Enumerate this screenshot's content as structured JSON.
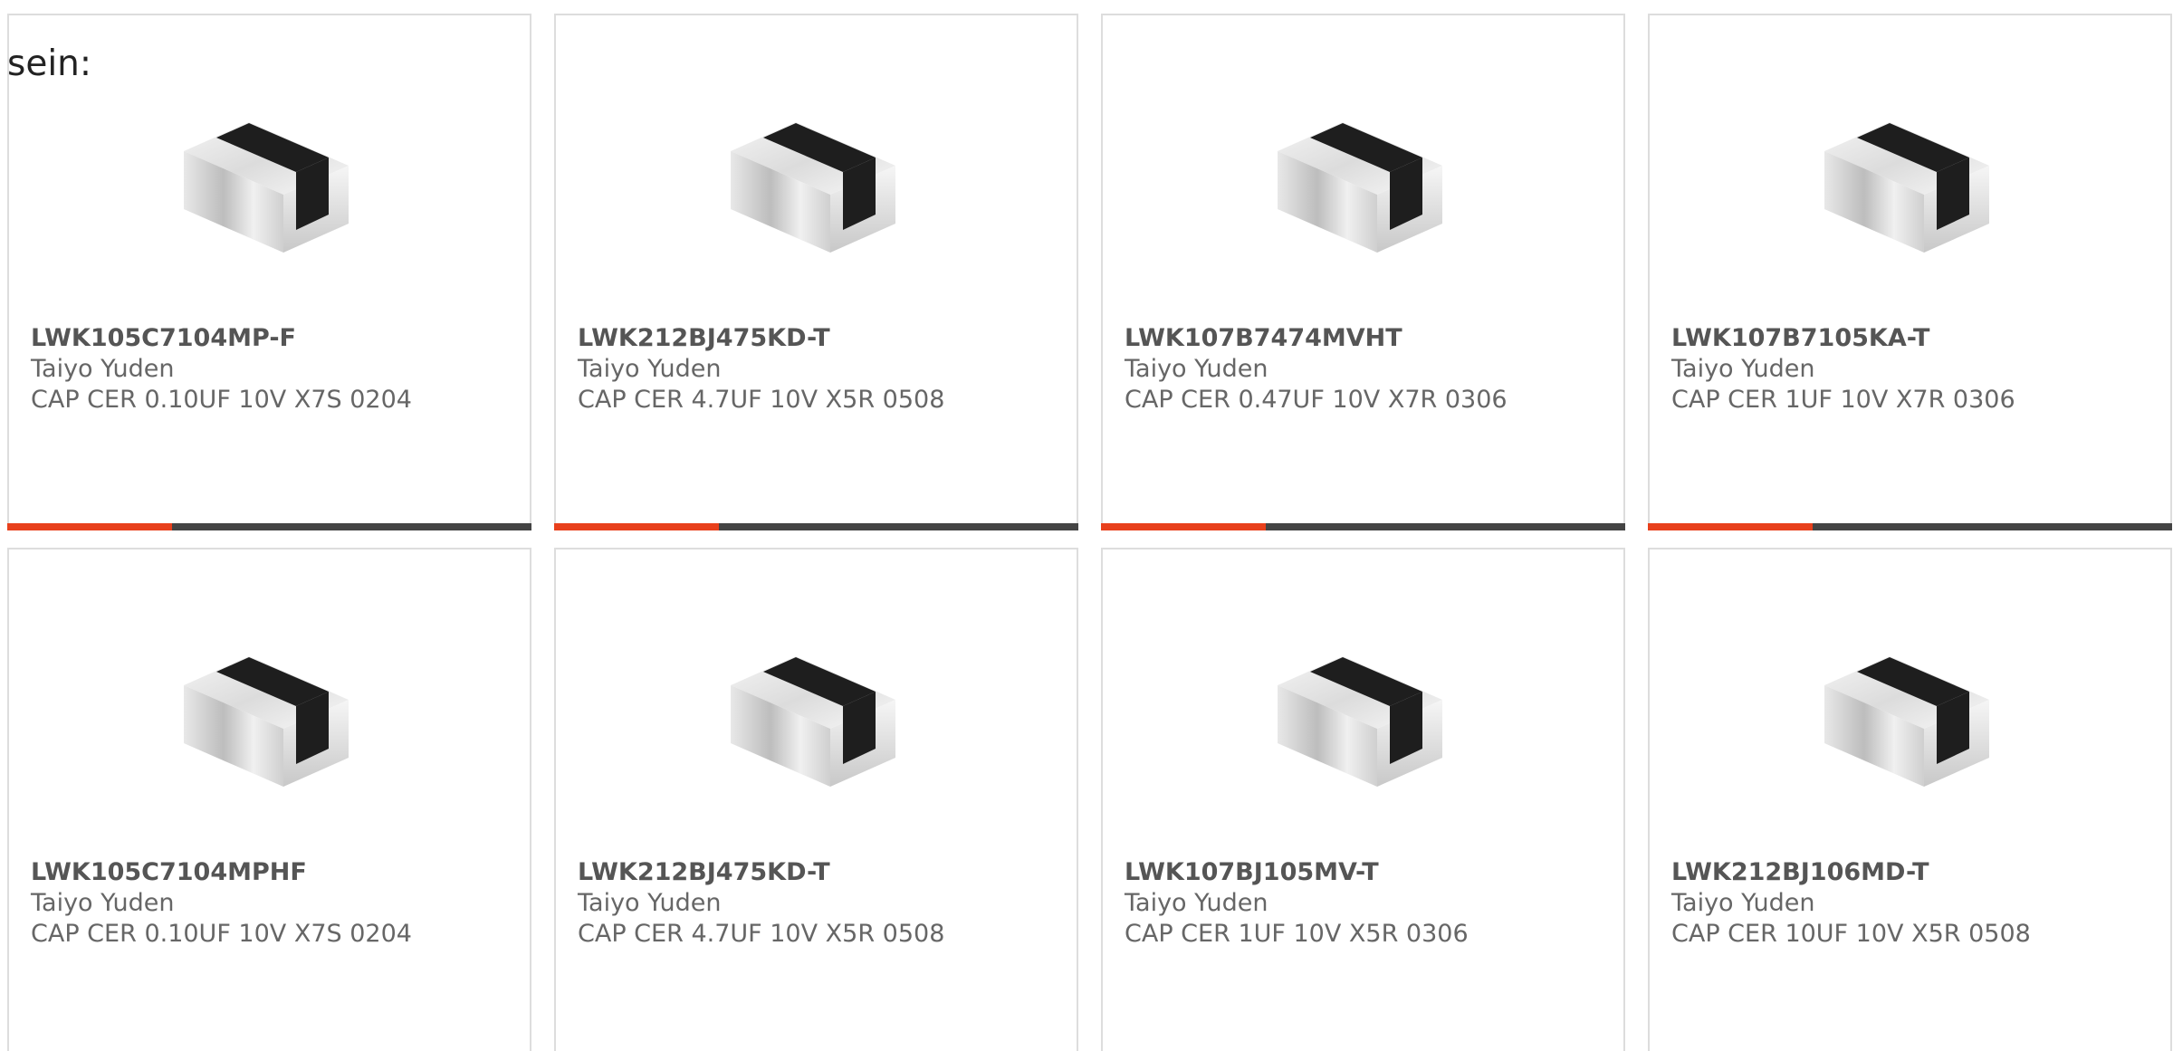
{
  "intro_text": "sein:",
  "colors": {
    "accent": "#e8401c",
    "bar": "#444444",
    "border": "#dddddd",
    "title": "#555555",
    "text": "#666666"
  },
  "products": [
    {
      "part_number": "LWK105C7104MP-F",
      "manufacturer": "Taiyo Yuden",
      "description": "CAP CER 0.10UF 10V X7S 0204",
      "image_icon": "chip-capacitor-image"
    },
    {
      "part_number": "LWK212BJ475KD-T",
      "manufacturer": "Taiyo Yuden",
      "description": "CAP CER 4.7UF 10V X5R 0508",
      "image_icon": "chip-capacitor-image"
    },
    {
      "part_number": "LWK107B7474MVHT",
      "manufacturer": "Taiyo Yuden",
      "description": "CAP CER 0.47UF 10V X7R 0306",
      "image_icon": "chip-capacitor-image"
    },
    {
      "part_number": "LWK107B7105KA-T",
      "manufacturer": "Taiyo Yuden",
      "description": "CAP CER 1UF 10V X7R 0306",
      "image_icon": "chip-capacitor-image"
    },
    {
      "part_number": "LWK105C7104MPHF",
      "manufacturer": "Taiyo Yuden",
      "description": "CAP CER 0.10UF 10V X7S 0204",
      "image_icon": "chip-capacitor-image"
    },
    {
      "part_number": "LWK212BJ475KD-T",
      "manufacturer": "Taiyo Yuden",
      "description": "CAP CER 4.7UF 10V X5R 0508",
      "image_icon": "chip-capacitor-image"
    },
    {
      "part_number": "LWK107BJ105MV-T",
      "manufacturer": "Taiyo Yuden",
      "description": "CAP CER 1UF 10V X5R 0306",
      "image_icon": "chip-capacitor-image"
    },
    {
      "part_number": "LWK212BJ106MD-T",
      "manufacturer": "Taiyo Yuden",
      "description": "CAP CER 10UF 10V X5R 0508",
      "image_icon": "chip-capacitor-image"
    }
  ]
}
